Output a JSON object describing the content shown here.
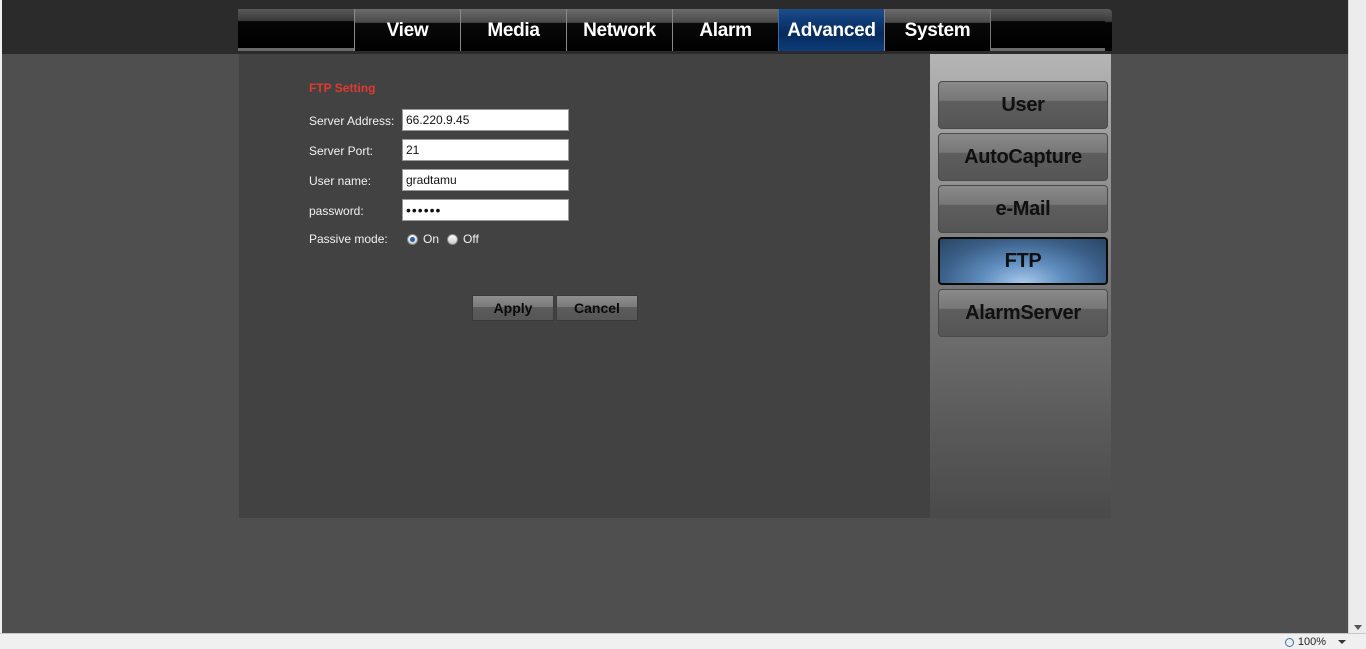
{
  "nav": {
    "tabs": [
      {
        "label": "View"
      },
      {
        "label": "Media"
      },
      {
        "label": "Network"
      },
      {
        "label": "Alarm"
      },
      {
        "label": "Advanced",
        "active": true
      },
      {
        "label": "System"
      }
    ]
  },
  "sidebar": {
    "items": [
      {
        "label": "User"
      },
      {
        "label": "AutoCapture"
      },
      {
        "label": "e-Mail"
      },
      {
        "label": "FTP",
        "active": true
      },
      {
        "label": "AlarmServer"
      }
    ]
  },
  "ftp": {
    "title": "FTP Setting",
    "server_address_label": "Server Address:",
    "server_address_value": "66.220.9.45",
    "server_port_label": "Server Port:",
    "server_port_value": "21",
    "username_label": "User name:",
    "username_value": "gradtamu",
    "password_label": "password:",
    "password_value": "••••••",
    "passive_label": "Passive mode:",
    "passive_on_label": "On",
    "passive_off_label": "Off",
    "passive_selected": "On"
  },
  "actions": {
    "apply_label": "Apply",
    "cancel_label": "Cancel"
  },
  "status": {
    "zoom": "100%"
  },
  "colors": {
    "accent_active": "#0e3a75",
    "section_title": "#e03a2f"
  }
}
